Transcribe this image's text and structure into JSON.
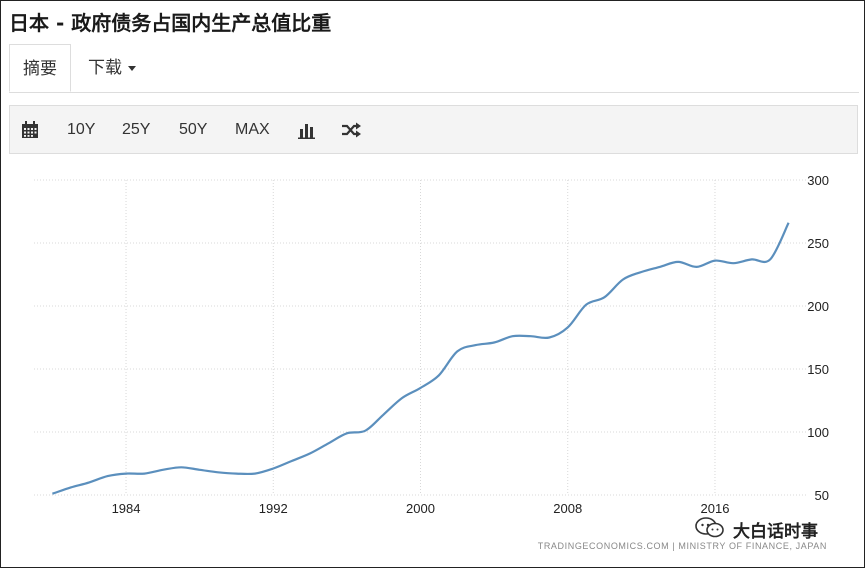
{
  "title": "日本 - 政府债务占国内生产总值比重",
  "tabs": {
    "summary": "摘要",
    "download": "下载"
  },
  "toolbar": {
    "range_10y": "10Y",
    "range_25y": "25Y",
    "range_50y": "50Y",
    "range_max": "MAX"
  },
  "icons": {
    "calendar": "calendar-icon",
    "bar_chart": "bar-chart-icon",
    "shuffle": "shuffle-icon"
  },
  "colors": {
    "line": "#5b8fbd",
    "grid": "#d8d8d8"
  },
  "source": "TRADINGECONOMICS.COM  |  MINISTRY OF FINANCE, JAPAN",
  "watermark": "大白话时事",
  "chart_data": {
    "type": "line",
    "title": "",
    "xlabel": "",
    "ylabel": "",
    "grid": true,
    "x_ticks": [
      "1984",
      "1992",
      "2000",
      "2008",
      "2016"
    ],
    "y_ticks": [
      "50",
      "100",
      "150",
      "200",
      "250",
      "300"
    ],
    "ylim": [
      50,
      300
    ],
    "xlim": [
      1979,
      2021
    ],
    "series": [
      {
        "x": [
          1980,
          1981,
          1982,
          1983,
          1984,
          1985,
          1986,
          1987,
          1988,
          1989,
          1990,
          1991,
          1992,
          1993,
          1994,
          1995,
          1996,
          1997,
          1998,
          1999,
          2000,
          2001,
          2002,
          2003,
          2004,
          2005,
          2006,
          2007,
          2008,
          2009,
          2010,
          2011,
          2012,
          2013,
          2014,
          2015,
          2016,
          2017,
          2018,
          2019,
          2020
        ],
        "values": [
          51,
          56,
          60,
          65,
          67,
          67,
          70,
          72,
          70,
          68,
          67,
          67,
          71,
          77,
          83,
          91,
          99,
          101,
          114,
          127,
          135,
          145,
          164,
          169,
          171,
          176,
          176,
          175,
          183,
          201,
          207,
          221,
          227,
          231,
          235,
          231,
          236,
          234,
          237,
          237,
          266
        ]
      }
    ]
  }
}
